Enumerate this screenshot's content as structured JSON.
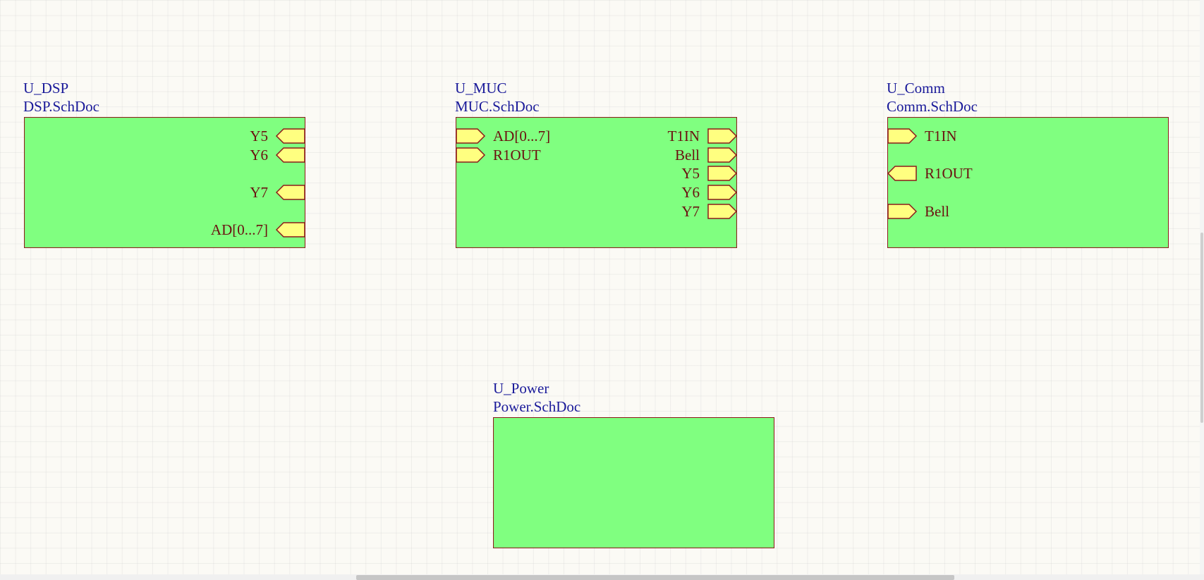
{
  "sheets": [
    {
      "designator": "U_DSP",
      "filename": "DSP.SchDoc",
      "entries": [
        {
          "label": "Y5",
          "side": "right",
          "io": "in"
        },
        {
          "label": "Y6",
          "side": "right",
          "io": "in"
        },
        {
          "label": "Y7",
          "side": "right",
          "io": "in"
        },
        {
          "label": "AD[0...7]",
          "side": "right",
          "io": "in"
        }
      ]
    },
    {
      "designator": "U_MUC",
      "filename": "MUC.SchDoc",
      "entries": [
        {
          "label": "AD[0...7]",
          "side": "left",
          "io": "out"
        },
        {
          "label": "R1OUT",
          "side": "left",
          "io": "out"
        },
        {
          "label": "T1IN",
          "side": "right",
          "io": "out"
        },
        {
          "label": "Bell",
          "side": "right",
          "io": "out"
        },
        {
          "label": "Y5",
          "side": "right",
          "io": "out"
        },
        {
          "label": "Y6",
          "side": "right",
          "io": "out"
        },
        {
          "label": "Y7",
          "side": "right",
          "io": "out"
        }
      ]
    },
    {
      "designator": "U_Comm",
      "filename": "Comm.SchDoc",
      "entries": [
        {
          "label": "T1IN",
          "side": "left",
          "io": "out"
        },
        {
          "label": "R1OUT",
          "side": "left",
          "io": "in"
        },
        {
          "label": "Bell",
          "side": "left",
          "io": "out"
        }
      ]
    },
    {
      "designator": "U_Power",
      "filename": "Power.SchDoc",
      "entries": []
    }
  ],
  "colors": {
    "canvas_background": "#fbfaf5",
    "sheet_fill": "#80ff80",
    "sheet_border": "#8b1a1a",
    "designator_text": "#1a1a9a",
    "entry_fill": "#ffff80",
    "entry_border": "#8b1a1a",
    "entry_text": "#6b1010"
  }
}
